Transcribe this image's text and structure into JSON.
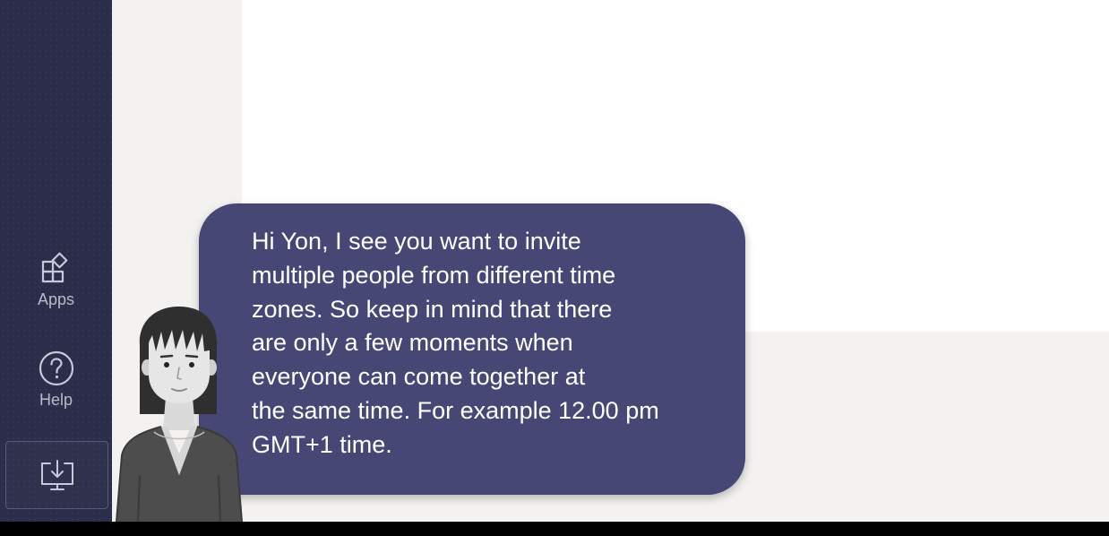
{
  "rail": {
    "items": [
      {
        "label": "Apps",
        "icon": "apps-icon"
      },
      {
        "label": "Help",
        "icon": "help-icon"
      }
    ],
    "download_icon": "download-app-icon"
  },
  "tip": {
    "lines": [
      "Hi Yon, I see you want to invite",
      "multiple people from different time",
      "zones. So keep in mind that there",
      "are only a few moments when",
      "everyone can come together at",
      "the same time. For example 12.00 pm",
      "GMT+1 time."
    ]
  },
  "colors": {
    "rail_bg": "#2b2d4a",
    "bubble_bg": "#464775",
    "panel_bg": "#f3f2f1",
    "content_bg": "#ffffff",
    "text_on_bubble": "#ffffff"
  }
}
